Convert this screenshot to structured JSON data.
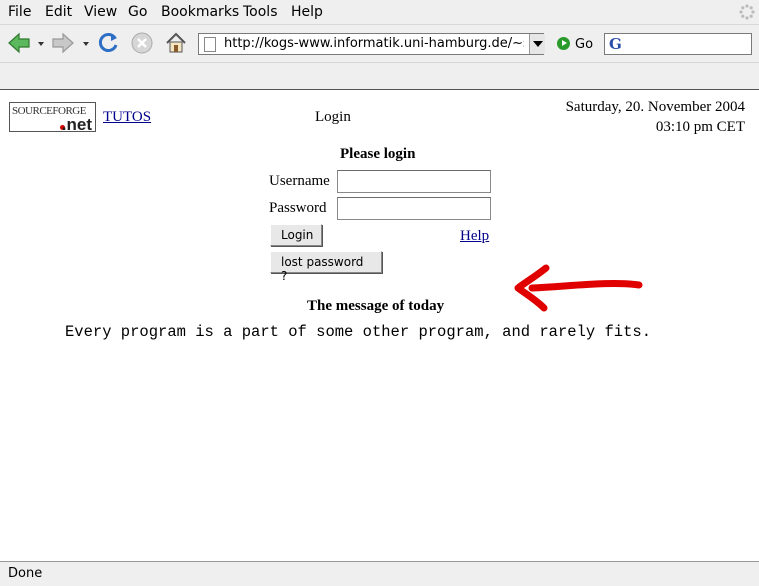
{
  "menubar": {
    "items": [
      "File",
      "Edit",
      "View",
      "Go",
      "Bookmarks",
      "Tools",
      "Help"
    ]
  },
  "navigation": {
    "url": "http://kogs-www.informatik.uni-hamburg.de/~schoen",
    "go_label": "Go",
    "search_engine_letter": "G"
  },
  "header": {
    "logo_text_top": "SOURCEFORGE",
    "logo_text_bottom": ".net",
    "tutos_link": "TUTOS",
    "page_title": "Login",
    "date": "Saturday, 20. November 2004",
    "time": "03:10 pm CET"
  },
  "login_form": {
    "heading": "Please login",
    "username_label": "Username",
    "username_value": "",
    "password_label": "Password",
    "password_value": "",
    "login_button": "Login",
    "help_link": "Help",
    "lost_password_button": "lost password ?"
  },
  "motd": {
    "title": "The message of today",
    "text": "Every program is a part of some other program, and rarely fits."
  },
  "annotation": {
    "arrow_color": "#e00000"
  },
  "statusbar": {
    "text": "Done"
  }
}
